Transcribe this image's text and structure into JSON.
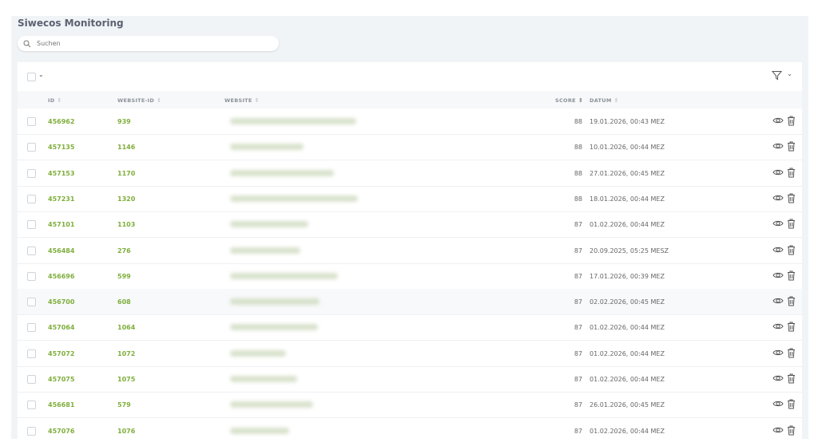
{
  "app": {
    "title": "Siwecos Monitoring"
  },
  "search": {
    "placeholder": "Suchen"
  },
  "table": {
    "columns": [
      "ID",
      "WEBSITE-ID",
      "WEBSITE",
      "SCORE",
      "DATUM"
    ],
    "rows": [
      {
        "id": "456962",
        "website_id": "939",
        "score": "88",
        "date": "19.01.2026, 00:43 MEZ"
      },
      {
        "id": "457135",
        "website_id": "1146",
        "score": "88",
        "date": "10.01.2026, 00:44 MEZ"
      },
      {
        "id": "457153",
        "website_id": "1170",
        "score": "88",
        "date": "27.01.2026, 00:45 MEZ"
      },
      {
        "id": "457231",
        "website_id": "1320",
        "score": "88",
        "date": "18.01.2026, 00:44 MEZ"
      },
      {
        "id": "457101",
        "website_id": "1103",
        "score": "87",
        "date": "01.02.2026, 00:44 MEZ"
      },
      {
        "id": "456484",
        "website_id": "276",
        "score": "87",
        "date": "20.09.2025, 05:25 MESZ"
      },
      {
        "id": "456696",
        "website_id": "599",
        "score": "87",
        "date": "17.01.2026, 00:39 MEZ"
      },
      {
        "id": "456700",
        "website_id": "608",
        "score": "87",
        "date": "02.02.2026, 00:45 MEZ"
      },
      {
        "id": "457064",
        "website_id": "1064",
        "score": "87",
        "date": "01.02.2026, 00:44 MEZ"
      },
      {
        "id": "457072",
        "website_id": "1072",
        "score": "87",
        "date": "01.02.2026, 00:44 MEZ"
      },
      {
        "id": "457075",
        "website_id": "1075",
        "score": "87",
        "date": "01.02.2026, 00:44 MEZ"
      },
      {
        "id": "456681",
        "website_id": "579",
        "score": "87",
        "date": "26.01.2026, 00:45 MEZ"
      },
      {
        "id": "457076",
        "website_id": "1076",
        "score": "87",
        "date": "01.02.2026, 00:44 MEZ"
      }
    ]
  },
  "colors": {
    "accent": "#7fae3c",
    "background": "#f1f4f7"
  }
}
